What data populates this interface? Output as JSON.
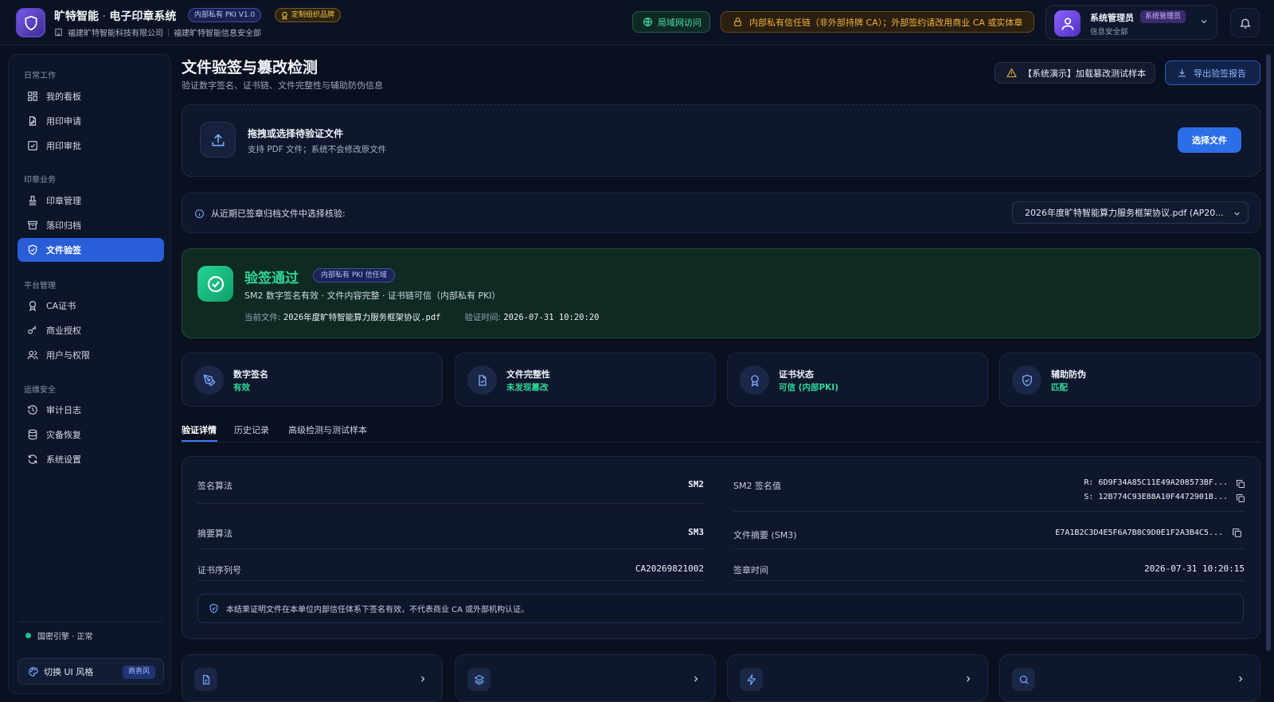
{
  "header": {
    "app_name": "旷特智能",
    "app_sep": " · ",
    "app_product": "电子印章系统",
    "pki_tag": "内部私有 PKI V1.0",
    "brand_tag": "定制组织品牌",
    "company": "福建旷特智能科技有限公司",
    "department": "福建旷特智能信息安全部",
    "lan_badge": "局域网访问",
    "trust_warning": "内部私有信任链（非外部持牌 CA）；外部签约请改用商业 CA 或实体章",
    "user_name": "系统管理员",
    "user_role": "系统管理员",
    "user_dept": "信息安全部"
  },
  "sidebar": {
    "groups": [
      {
        "title": "日常工作"
      },
      {
        "title": "印章业务"
      },
      {
        "title": "平台管理"
      },
      {
        "title": "运维安全"
      }
    ],
    "items": [
      {
        "label": "我的看板",
        "icon": "dashboard-icon"
      },
      {
        "label": "用印申请",
        "icon": "file-edit-icon"
      },
      {
        "label": "用印审批",
        "icon": "checkbox-icon"
      },
      {
        "label": "印章管理",
        "icon": "stamp-icon"
      },
      {
        "label": "落印归档",
        "icon": "archive-icon"
      },
      {
        "label": "文件验签",
        "icon": "shield-check-icon",
        "active": true
      },
      {
        "label": "CA证书",
        "icon": "award-icon"
      },
      {
        "label": "商业授权",
        "icon": "key-icon"
      },
      {
        "label": "用户与权限",
        "icon": "users-icon"
      },
      {
        "label": "审计日志",
        "icon": "history-icon"
      },
      {
        "label": "灾备恢复",
        "icon": "database-icon"
      },
      {
        "label": "系统设置",
        "icon": "refresh-icon"
      }
    ],
    "engine_status": "国密引擎 · 正常",
    "theme_button": "切换 UI 风格",
    "theme_tag": "商务风"
  },
  "page": {
    "title": "文件验签与篡改检测",
    "subtitle": "验证数字签名、证书链、文件完整性与辅助防伪信息",
    "demo_button": "【系统演示】加载篡改测试样本",
    "export_button": "导出验签报告"
  },
  "upload": {
    "title": "拖拽或选择待验证文件",
    "subtitle": "支持 PDF 文件；系统不会修改原文件",
    "button": "选择文件"
  },
  "recent": {
    "label": "从近期已签章归档文件中选择核验:",
    "selected": "2026年度旷特智能算力服务框架协议.pdf (AP20..."
  },
  "result": {
    "title": "验签通过",
    "tag": "内部私有 PKI 信任域",
    "description": "SM2 数字签名有效 · 文件内容完整 · 证书链可信（内部私有 PKI）",
    "file_label": "当前文件:",
    "file_value": "2026年度旷特智能算力服务框架协议.pdf",
    "time_label": "验证时间:",
    "time_value": "2026-07-31 10:20:20"
  },
  "stats": [
    {
      "name": "数字签名",
      "value": "有效",
      "icon": "pen-tool-icon"
    },
    {
      "name": "文件完整性",
      "value": "未发现篡改",
      "icon": "file-check-icon"
    },
    {
      "name": "证书状态",
      "value": "可信 (内部PKI)",
      "icon": "award-icon"
    },
    {
      "name": "辅助防伪",
      "value": "匹配",
      "icon": "shield-check-icon"
    }
  ],
  "tabs": [
    {
      "label": "验证详情",
      "active": true
    },
    {
      "label": "历史记录"
    },
    {
      "label": "高级检测与测试样本"
    }
  ],
  "details": {
    "sign_algo_label": "签名算法",
    "sign_algo_value": "SM2",
    "digest_algo_label": "摘要算法",
    "digest_algo_value": "SM3",
    "cert_serial_label": "证书序列号",
    "cert_serial_value": "CA20269821002",
    "sm2_sig_label": "SM2 签名值",
    "sm2_sig_r": "R: 6D9F34A85C11E49A208573BF...",
    "sm2_sig_s": "S: 12B774C93E88A10F4472901B...",
    "file_digest_label": "文件摘要 (SM3)",
    "file_digest_value": "E7A1B2C3D4E5F6A7B8C9D0E1F2A3B4C5...",
    "sign_time_label": "签章时间",
    "sign_time_value": "2026-07-31 10:20:15",
    "note": "本结果证明文件在本单位内部信任体系下签名有效，不代表商业 CA 或外部机构认证。"
  },
  "bottom_cards": [
    {
      "icon": "file-icon"
    },
    {
      "icon": "layers-icon"
    },
    {
      "icon": "zap-icon"
    },
    {
      "icon": "search-icon"
    }
  ],
  "colors": {
    "accent": "#2b6ee8",
    "success": "#2fd898",
    "warning": "#f2b33d",
    "background": "#0a1020"
  }
}
